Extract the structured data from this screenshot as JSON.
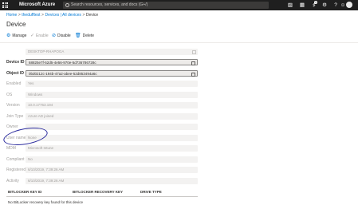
{
  "topbar": {
    "brand": "Microsoft Azure",
    "search_placeholder": "Search resources, services, and docs (G+/)",
    "icons": [
      "cloud-shell-icon",
      "directory-filter-icon",
      "notifications-icon",
      "settings-icon",
      "help-icon",
      "feedback-icon"
    ],
    "notification_count": "1"
  },
  "breadcrumb": {
    "items": [
      "Home",
      "thedufftest",
      "Devices | All devices",
      "Device"
    ],
    "separator": ">"
  },
  "page": {
    "title": "Device"
  },
  "commands": {
    "manage": "Manage",
    "enable": "Enable",
    "disable": "Disable",
    "delete": "Delete"
  },
  "fields": [
    {
      "label": "",
      "value": "DESKTOP-RHAPOGA"
    },
    {
      "label": "Device ID",
      "value": "68825e7f-52d5-4e56-970e-5d736786728c"
    },
    {
      "label": "Object ID",
      "value": "0bd0212c-194b-47a2-abee-52d853494a6c"
    },
    {
      "label": "Enabled",
      "value": "Yes"
    },
    {
      "label": "OS",
      "value": "Windows"
    },
    {
      "label": "Version",
      "value": "10.0.17763.194"
    },
    {
      "label": "Join Type",
      "value": "Azure AD joined"
    },
    {
      "label": "Owner",
      "value": ""
    },
    {
      "label": "User name",
      "value": "None"
    },
    {
      "label": "MDM",
      "value": "Microsoft Intune"
    },
    {
      "label": "Compliant",
      "value": "No"
    },
    {
      "label": "Registered",
      "value": "6/10/2019, 7:39:26 AM"
    },
    {
      "label": "Activity",
      "value": "6/10/2019, 7:39:26 AM"
    }
  ],
  "bitlocker": {
    "columns": [
      "BITLOCKER KEY ID",
      "BITLOCKER RECOVERY KEY",
      "DRIVE TYPE"
    ],
    "empty_message": "No BitLocker recovery key found for this device"
  },
  "colors": {
    "topbar": "#1f1f1f",
    "accent": "#0078d4",
    "annotation": "#2b2b9e"
  }
}
